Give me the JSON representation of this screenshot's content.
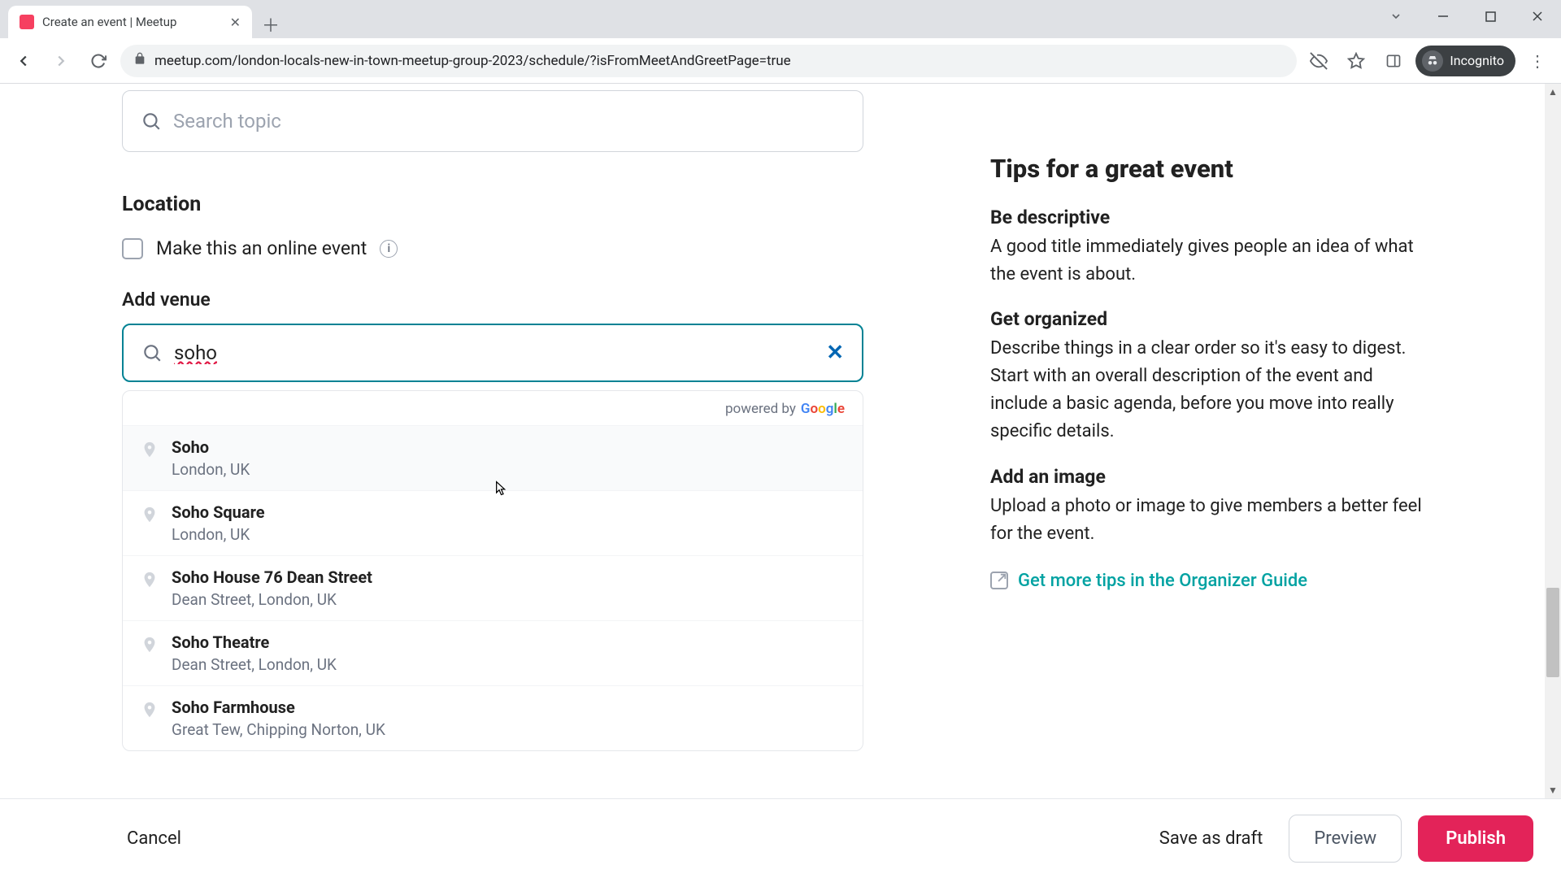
{
  "browser": {
    "tab_title": "Create an event | Meetup",
    "url": "meetup.com/london-locals-new-in-town-meetup-group-2023/schedule/?isFromMeetAndGreetPage=true",
    "mode_label": "Incognito"
  },
  "form": {
    "search_placeholder": "Search topic",
    "location_label": "Location",
    "online_checkbox_label": "Make this an online event",
    "venue_label": "Add venue",
    "venue_value": "soho",
    "powered_by_prefix": "powered by",
    "suggestions": [
      {
        "name": "Soho",
        "sub": "London, UK"
      },
      {
        "name": "Soho Square",
        "sub": "London, UK"
      },
      {
        "name": "Soho House 76 Dean Street",
        "sub": "Dean Street, London, UK"
      },
      {
        "name": "Soho Theatre",
        "sub": "Dean Street, London, UK"
      },
      {
        "name": "Soho Farmhouse",
        "sub": "Great Tew, Chipping Norton, UK"
      }
    ]
  },
  "tips": {
    "title": "Tips for a great event",
    "items": [
      {
        "heading": "Be descriptive",
        "body": "A good title immediately gives people an idea of what the event is about."
      },
      {
        "heading": "Get organized",
        "body": "Describe things in a clear order so it's easy to digest. Start with an overall description of the event and include a basic agenda, before you move into really specific details."
      },
      {
        "heading": "Add an image",
        "body": "Upload a photo or image to give members a better feel for the event."
      }
    ],
    "guide_link": "Get more tips in the Organizer Guide"
  },
  "footer": {
    "cancel": "Cancel",
    "save_draft": "Save as draft",
    "preview": "Preview",
    "publish": "Publish"
  }
}
